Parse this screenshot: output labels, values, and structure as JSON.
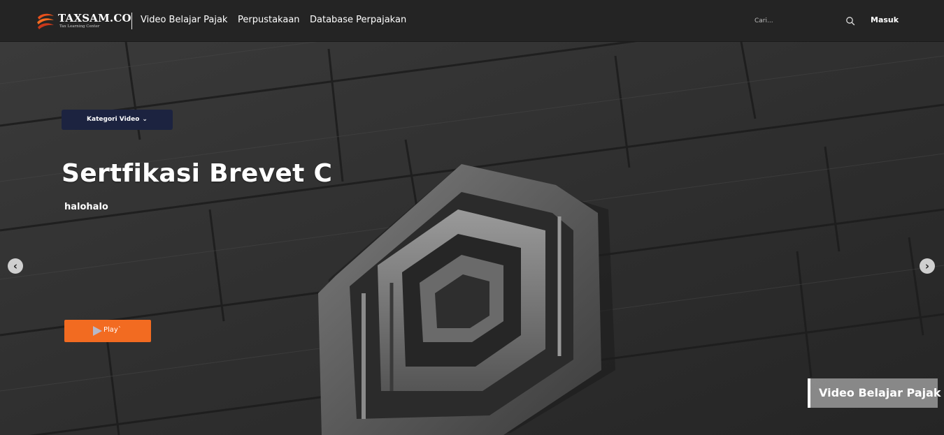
{
  "brand": {
    "name": "TAXSAM.CO",
    "tagline": "Tax Learning Center",
    "accent_color": "#f26b21",
    "icon": "taxsam-swirl-logo"
  },
  "nav": {
    "items": [
      "Video Belajar Pajak",
      "Perpustakaan",
      "Database Perpajakan"
    ]
  },
  "search": {
    "placeholder": "Cari...",
    "icon": "search-icon"
  },
  "auth": {
    "login_label": "Masuk"
  },
  "hero": {
    "category_button_label": "Kategori Video",
    "category_button_icon": "chevron-down-icon",
    "title": "Sertfikasi Brevet C",
    "subtitle": "halohalo",
    "play_label": "Play`",
    "play_icon": "play-icon",
    "tag_label": "Video Belajar Pajak",
    "prev_icon": "chevron-left-icon",
    "next_icon": "chevron-right-icon"
  }
}
